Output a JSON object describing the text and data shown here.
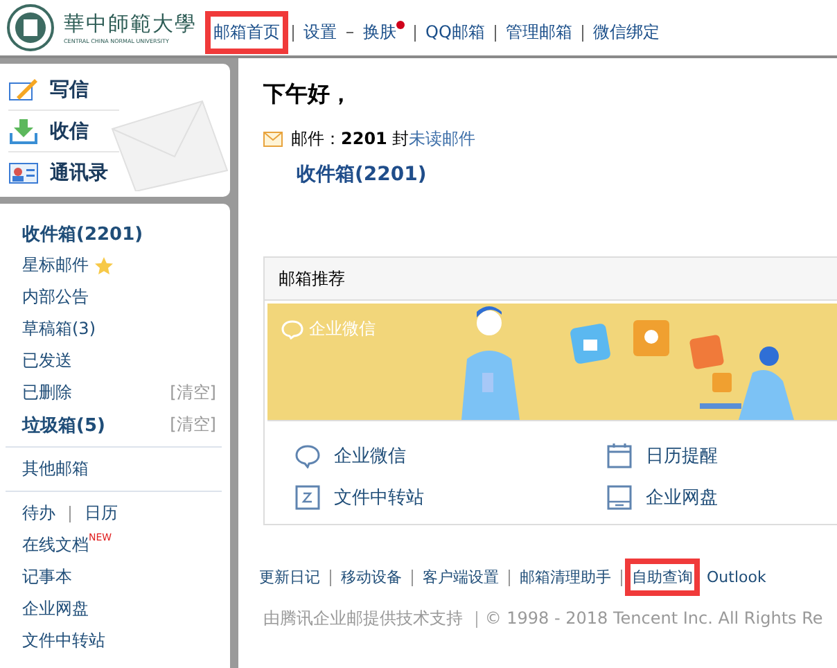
{
  "header": {
    "logo_text": "華中師範大學",
    "logo_subtext": "CENTRAL CHINA NORMAL UNIVERSITY",
    "nav": [
      {
        "label": "邮箱首页",
        "highlighted": true,
        "dot": false
      },
      {
        "label": "设置",
        "highlighted": false,
        "dot": false
      },
      {
        "label": "换肤",
        "highlighted": false,
        "dot": true
      },
      {
        "label": "QQ邮箱",
        "highlighted": false,
        "dot": false
      },
      {
        "label": "管理邮箱",
        "highlighted": false,
        "dot": false
      },
      {
        "label": "微信绑定",
        "highlighted": false,
        "dot": false
      }
    ]
  },
  "quick_actions": [
    {
      "kind": "compose",
      "label": "写信"
    },
    {
      "kind": "inbox",
      "label": "收信"
    },
    {
      "kind": "contacts",
      "label": "通讯录"
    }
  ],
  "folders": [
    {
      "label": "收件箱(2201)",
      "bold": true,
      "star": false
    },
    {
      "label": "星标邮件",
      "bold": false,
      "star": true
    },
    {
      "label": "内部公告",
      "bold": false,
      "star": false
    },
    {
      "label": "草稿箱(3)",
      "bold": false,
      "star": false
    },
    {
      "label": "已发送",
      "bold": false,
      "star": false
    },
    {
      "label": "已删除",
      "bold": false,
      "star": false,
      "action": "[清空]"
    },
    {
      "label": "垃圾箱(5)",
      "bold": true,
      "star": false,
      "action": "[清空]"
    }
  ],
  "other_mailbox": "其他邮箱",
  "tools": [
    {
      "items": [
        "待办",
        "日历"
      ]
    },
    {
      "items": [
        "在线文档"
      ],
      "badge": "NEW"
    },
    {
      "items": [
        "记事本"
      ]
    },
    {
      "items": [
        "企业网盘"
      ]
    },
    {
      "items": [
        "文件中转站"
      ]
    }
  ],
  "greeting": "下午好，",
  "mail_summary": {
    "text": "邮件：**2201** 封",
    "link": "未读邮件"
  },
  "inbox_link": "收件箱(2201)",
  "recommend": {
    "title": "邮箱推荐",
    "banner_label": "企业微信",
    "items": [
      {
        "kind": "chat",
        "label": "企业微信"
      },
      {
        "kind": "calendar",
        "label": "日历提醒"
      },
      {
        "kind": "transfer",
        "label": "文件中转站"
      },
      {
        "kind": "disk",
        "label": "企业网盘"
      }
    ]
  },
  "footer_links": [
    {
      "label": "更新日记",
      "highlighted": false
    },
    {
      "label": "移动设备",
      "highlighted": false
    },
    {
      "label": "客户端设置",
      "highlighted": false
    },
    {
      "label": "邮箱清理助手",
      "highlighted": false
    },
    {
      "label": "自助查询",
      "highlighted": true
    },
    {
      "label": "Outlook",
      "highlighted": false
    }
  ],
  "copyright": "由腾讯企业邮提供技术支持 ｜© 1998 - 2018 Tencent Inc. All Rights Re"
}
